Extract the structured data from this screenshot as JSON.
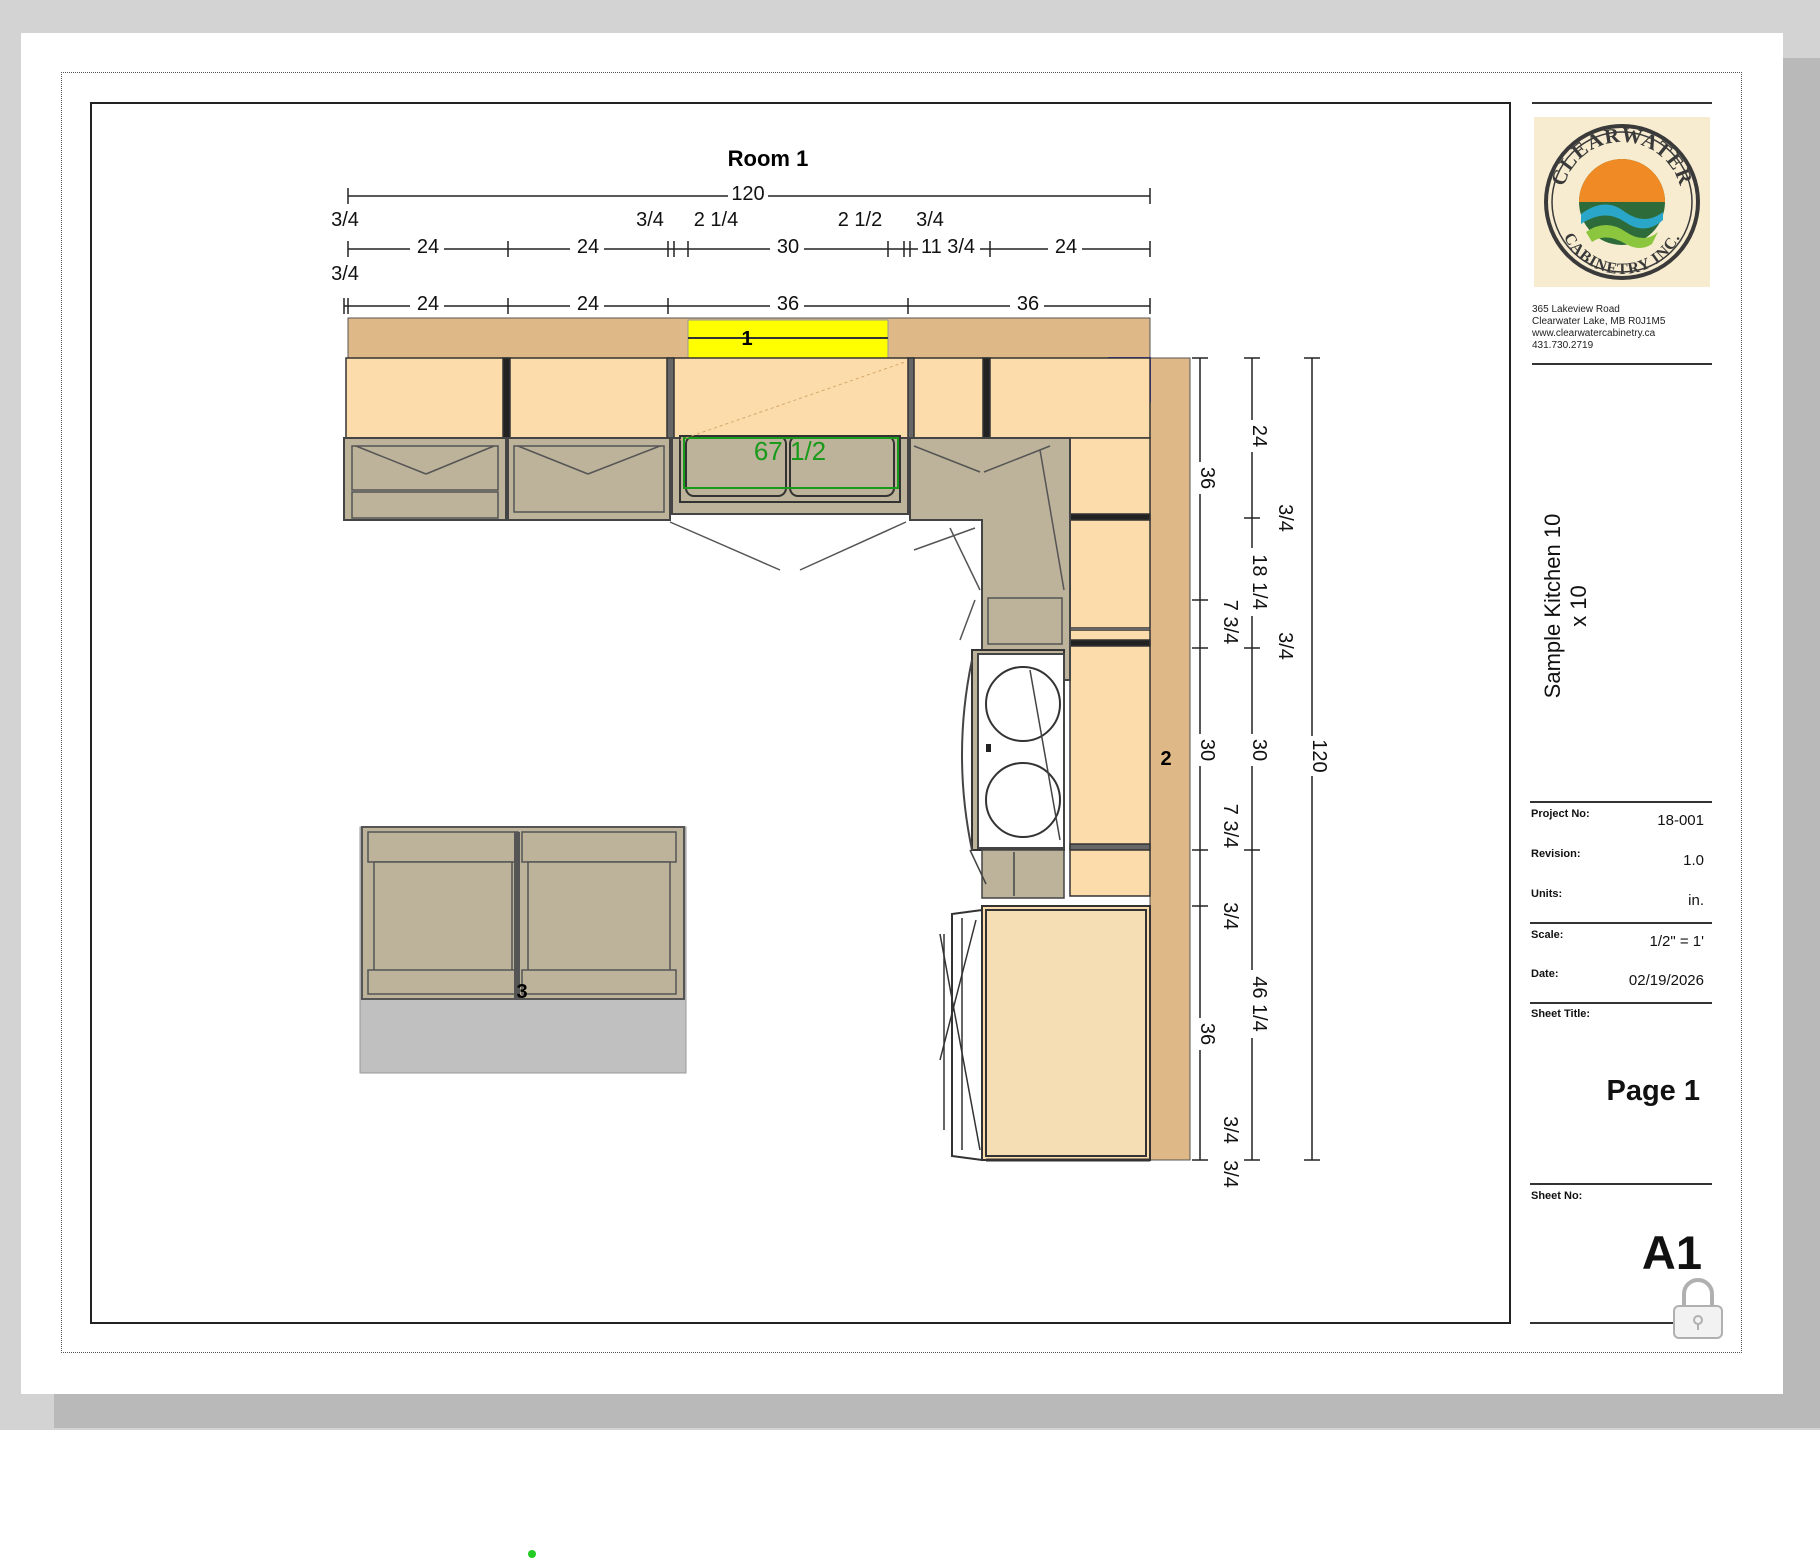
{
  "room": {
    "title": "Room 1",
    "labels": {
      "wall_top": "1",
      "wall_right": "2",
      "island": "3"
    },
    "sink_dimension": "67 1/2"
  },
  "dimensions": {
    "top_overall": "120",
    "top_row1": [
      "3/4",
      "3/4",
      "2 1/4",
      "2 1/2",
      "3/4"
    ],
    "top_row2": [
      "3/4",
      "24",
      "24",
      "30",
      "11 3/4",
      "24"
    ],
    "top_row3": [
      "24",
      "24",
      "36",
      "36"
    ],
    "right_row1": [
      "36",
      "7 3/4",
      "30",
      "7 3/4",
      "36",
      "3/4",
      "3/4",
      "3/4"
    ],
    "right_row2": [
      "24",
      "18 1/4",
      "30",
      "46 1/4"
    ],
    "right_row3": [
      "3/4",
      "3/4"
    ],
    "right_overall": "120"
  },
  "logo": {
    "arc_top": "CLEARWATER",
    "arc_bottom": "CABINETRY INC."
  },
  "title_block": {
    "address_lines": [
      "365 Lakeview Road",
      "Clearwater Lake, MB R0J1M5",
      "www.clearwatercabinetry.ca",
      "431.730.2719"
    ],
    "sheet_title": "Sample Kitchen 10 x 10",
    "project_no_label": "Project No:",
    "project_no": "18-001",
    "revision_label": "Revision:",
    "revision": "1.0",
    "units_label": "Units:",
    "units": "in.",
    "scale_label": "Scale:",
    "scale": "1/2\" = 1'",
    "date_label": "Date:",
    "date": "02/19/2026",
    "sheet_title_label": "Sheet Title:",
    "page_label": "Page 1",
    "sheet_no_label": "Sheet No:",
    "sheet_no": "A1"
  },
  "colors": {
    "countertop": "#deb887",
    "cabinet": "#fcdcab",
    "base_gray": "#bdb29a",
    "highlight": "#ffff00",
    "sink_green": "#1a9a1a",
    "corner_blue": "#4a4aff"
  }
}
